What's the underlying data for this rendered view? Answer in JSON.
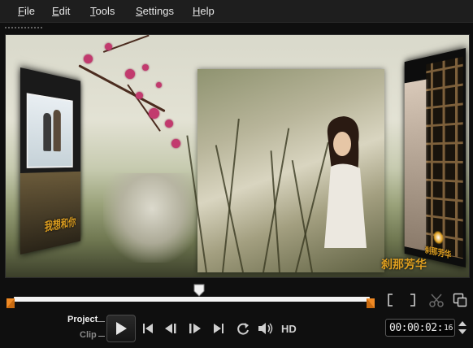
{
  "menu": {
    "items": [
      "File",
      "Edit",
      "Tools",
      "Settings",
      "Help"
    ]
  },
  "preview": {
    "overlay_text_left": "我想和你",
    "overlay_text_bottom": "刹那芳华",
    "overlay_text_right": "刹那芳华"
  },
  "timeline": {
    "playhead_position": 0.52
  },
  "controls": {
    "mode_project": "Project",
    "mode_clip": "Clip",
    "hd_label": "HD",
    "timecode_main": "00:00:02:",
    "timecode_frame": "16"
  },
  "icons": {
    "trim_in": "mark-in-bracket-icon",
    "trim_out": "mark-out-bracket-icon",
    "split": "scissors-icon",
    "enlarge": "enlarge-preview-icon",
    "play": "play-icon",
    "home": "go-to-start-icon",
    "prev": "previous-frame-icon",
    "next": "next-frame-icon",
    "end": "go-to-end-icon",
    "repeat": "repeat-icon",
    "volume": "volume-icon"
  },
  "colors": {
    "accent": "#f08a24",
    "menubar": "#1e1e1e",
    "background": "#0f0f0f"
  }
}
